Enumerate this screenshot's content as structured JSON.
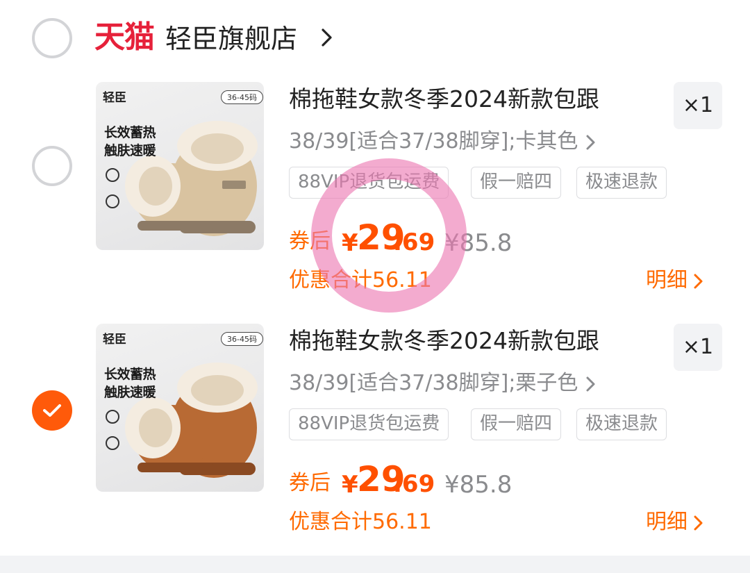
{
  "shop": {
    "platform_logo_text": "天猫",
    "name": "轻臣旗舰店",
    "selected": false
  },
  "items": [
    {
      "selected": false,
      "thumb": {
        "brand": "轻臣",
        "size_badge": "36-45码",
        "tagline_1": "长效蓄热",
        "tagline_2": "触肤速暖",
        "shoe_color": "#d9c3a0"
      },
      "title": "棉拖鞋女款冬季2024新款包跟",
      "quantity": "×1",
      "sku": "38/39[适合37/38脚穿];卡其色",
      "tags": [
        "88VIP退货包运费",
        "假一赔四",
        "极速退款"
      ],
      "price_label": "券后",
      "price_currency": "¥",
      "price_int": "29",
      "price_dec": ".69",
      "original_price": "¥85.8",
      "discount_text": "优惠合计56.11",
      "detail_label": "明细"
    },
    {
      "selected": true,
      "thumb": {
        "brand": "轻臣",
        "size_badge": "36-45码",
        "tagline_1": "长效蓄热",
        "tagline_2": "触肤速暖",
        "shoe_color": "#b86a34"
      },
      "title": "棉拖鞋女款冬季2024新款包跟",
      "quantity": "×1",
      "sku": "38/39[适合37/38脚穿];栗子色",
      "tags": [
        "88VIP退货包运费",
        "假一赔四",
        "极速退款"
      ],
      "price_label": "券后",
      "price_currency": "¥",
      "price_int": "29",
      "price_dec": ".69",
      "original_price": "¥85.8",
      "discount_text": "优惠合计56.11",
      "detail_label": "明细"
    }
  ],
  "colors": {
    "accent_orange": "#ff5000",
    "tmall_red": "#e6213a",
    "checked_radio": "#ff5a0a",
    "annotation_pink": "#ec78b2"
  }
}
